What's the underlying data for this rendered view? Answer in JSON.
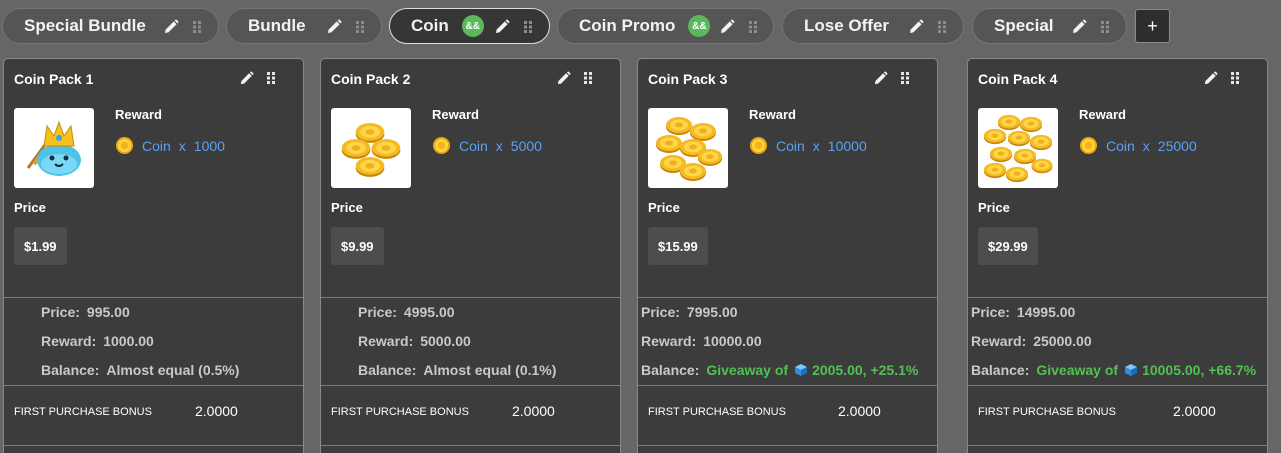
{
  "tabs": [
    {
      "label": "Special Bundle",
      "badge": ""
    },
    {
      "label": "Bundle",
      "badge": ""
    },
    {
      "label": "Coin",
      "badge": "&&"
    },
    {
      "label": "Coin Promo",
      "badge": "&&"
    },
    {
      "label": "Lose Offer",
      "badge": ""
    },
    {
      "label": "Special",
      "badge": ""
    }
  ],
  "active_tab": "Coin",
  "add_button": "+",
  "cards": [
    {
      "title": "Coin Pack 1",
      "reward_title": "Reward",
      "reward_item": "Coin",
      "reward_x": "x",
      "reward_qty": "1000",
      "price_title": "Price",
      "price": "$1.99",
      "stats": {
        "price_k": "Price:",
        "price_v": "995.00",
        "reward_k": "Reward:",
        "reward_v": "1000.00",
        "balance_k": "Balance:",
        "balance_v": "Almost equal (0.5%)"
      },
      "bonus_label": "FIRST PURCHASE BONUS",
      "bonus_value": "2.0000"
    },
    {
      "title": "Coin Pack 2",
      "reward_title": "Reward",
      "reward_item": "Coin",
      "reward_x": "x",
      "reward_qty": "5000",
      "price_title": "Price",
      "price": "$9.99",
      "stats": {
        "price_k": "Price:",
        "price_v": "4995.00",
        "reward_k": "Reward:",
        "reward_v": "5000.00",
        "balance_k": "Balance:",
        "balance_v": "Almost equal (0.1%)"
      },
      "bonus_label": "FIRST PURCHASE BONUS",
      "bonus_value": "2.0000"
    },
    {
      "title": "Coin Pack 3",
      "reward_title": "Reward",
      "reward_item": "Coin",
      "reward_x": "x",
      "reward_qty": "10000",
      "price_title": "Price",
      "price": "$15.99",
      "stats": {
        "price_k": "Price:",
        "price_v": "7995.00",
        "reward_k": "Reward:",
        "reward_v": "10000.00",
        "balance_k": "Balance:",
        "balance_prefix": "Giveaway of",
        "balance_v": "2005.00, +25.1%"
      },
      "bonus_label": "FIRST PURCHASE BONUS",
      "bonus_value": "2.0000"
    },
    {
      "title": "Coin Pack 4",
      "reward_title": "Reward",
      "reward_item": "Coin",
      "reward_x": "x",
      "reward_qty": "25000",
      "price_title": "Price",
      "price": "$29.99",
      "stats": {
        "price_k": "Price:",
        "price_v": "14995.00",
        "reward_k": "Reward:",
        "reward_v": "25000.00",
        "balance_k": "Balance:",
        "balance_prefix": "Giveaway of",
        "balance_v": "10005.00, +66.7%"
      },
      "bonus_label": "FIRST PURCHASE BONUS",
      "bonus_value": "2.0000"
    }
  ],
  "icons": {
    "edit": "pencil-icon",
    "drag": "drag-handle-icon",
    "coin": "coin-icon",
    "gem": "cube-icon"
  },
  "colors": {
    "background": "#666666",
    "card": "#3c3c3c",
    "link_blue": "#5aa2f0",
    "positive_green": "#52c152",
    "badge_green": "#5cb85c"
  }
}
